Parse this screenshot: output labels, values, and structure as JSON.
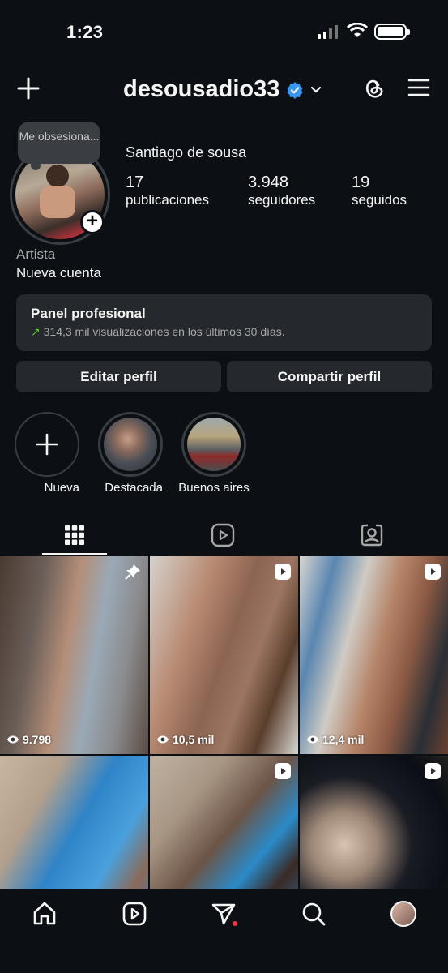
{
  "status": {
    "time": "1:23"
  },
  "header": {
    "username": "desousadio33"
  },
  "profile": {
    "note": "Me obsesiona...",
    "full_name": "Santiago de sousa",
    "stats": [
      {
        "value": "17",
        "label": "publicaciones"
      },
      {
        "value": "3.948",
        "label": "seguidores"
      },
      {
        "value": "19",
        "label": "seguidos"
      }
    ],
    "category": "Artista",
    "bio": "Nueva cuenta"
  },
  "panel": {
    "title": "Panel profesional",
    "subtitle": "314,3 mil visualizaciones en los últimos 30 días."
  },
  "buttons": {
    "edit": "Editar perfil",
    "share": "Compartir perfil"
  },
  "highlights": [
    {
      "label": "Nueva"
    },
    {
      "label": "Destacada"
    },
    {
      "label": "Buenos  aires"
    }
  ],
  "posts": [
    {
      "views": "9.798",
      "badge": "pin-icon"
    },
    {
      "views": "10,5 mil",
      "badge": "reel-icon"
    },
    {
      "views": "12,4 mil",
      "badge": "reel-icon"
    },
    {
      "views": "",
      "badge": ""
    },
    {
      "views": "",
      "badge": "reel-icon"
    },
    {
      "views": "",
      "badge": "reel-icon"
    }
  ],
  "colors": {
    "background": "#0c1014",
    "card": "#25292e",
    "verified": "#3797f0",
    "trend": "#58c322",
    "notification": "#ff3040"
  }
}
